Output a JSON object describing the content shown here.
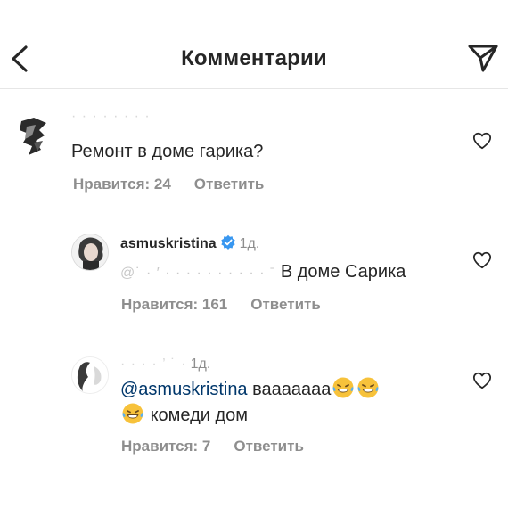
{
  "header": {
    "title": "Комментарии",
    "back_icon": "chevron-left-icon",
    "share_icon": "paper-plane-icon"
  },
  "comments": [
    {
      "username": "· · · · · · · ·",
      "text": "Ремонт в доме гарика?",
      "likes_label": "Нравится: 24",
      "reply_label": "Ответить"
    },
    {
      "username": "asmuskristina",
      "time": "1д.",
      "mention": "@˙ · ′ · · · · · · · · · · ˉ",
      "text": "В доме Сарика",
      "likes_label": "Нравится: 161",
      "reply_label": "Ответить"
    },
    {
      "username": "· · · · ’ ˙ ·",
      "time": "1д.",
      "mention": "@asmuskristina",
      "text_line1": "вааааааа",
      "text_line2": "комеди дом",
      "likes_label": "Нравится: 7",
      "reply_label": "Ответить"
    }
  ],
  "colors": {
    "text": "#262626",
    "secondary": "#8e8e8e",
    "mention": "#00376b",
    "verified": "#3897f0",
    "divider": "#e6e6e6"
  }
}
